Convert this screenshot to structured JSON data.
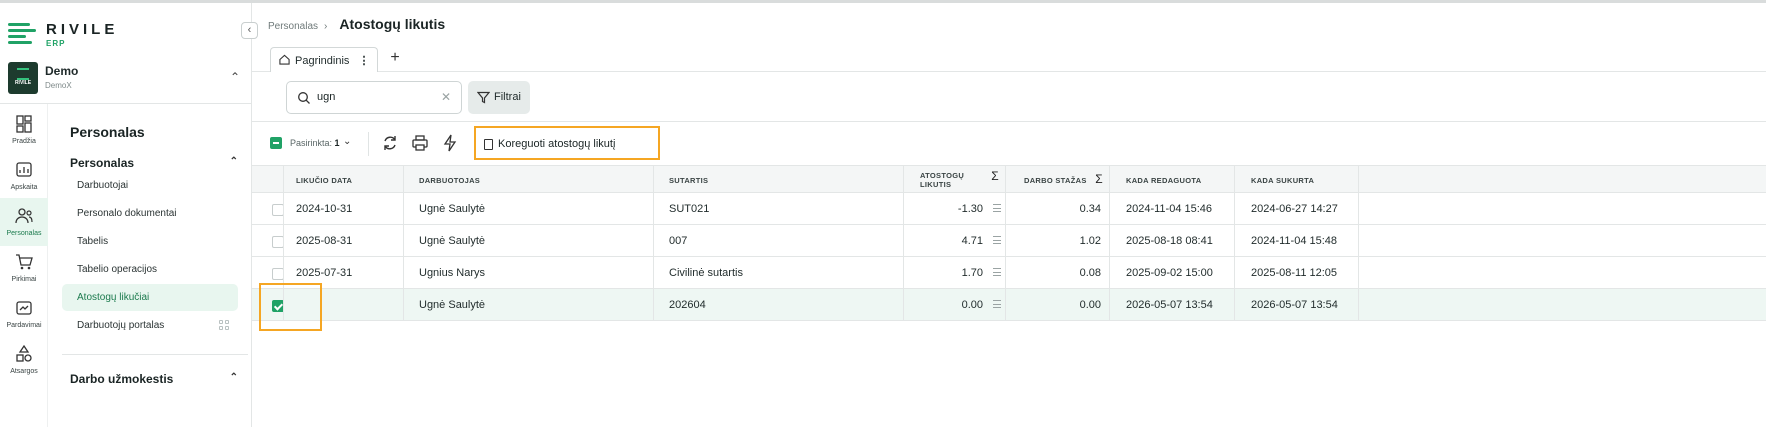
{
  "brand": {
    "name": "RIVILE",
    "sub": "ERP"
  },
  "company": {
    "name": "Demo",
    "sub": "DemoX",
    "logo_text": "RIVILE"
  },
  "rail": [
    {
      "label": "Pradžia",
      "icon": "dashboard-icon"
    },
    {
      "label": "Apskaita",
      "icon": "chart-icon"
    },
    {
      "label": "Personalas",
      "icon": "people-icon"
    },
    {
      "label": "Pirkimai",
      "icon": "cart-icon"
    },
    {
      "label": "Pardavimai",
      "icon": "sales-icon"
    },
    {
      "label": "Atsargos",
      "icon": "inventory-icon"
    }
  ],
  "submenu": {
    "title": "Personalas",
    "group1": "Personalas",
    "items": [
      "Darbuotojai",
      "Personalo dokumentai",
      "Tabelis",
      "Tabelio operacijos",
      "Atostogų likučiai",
      "Darbuotojų portalas"
    ],
    "group2": "Darbo užmokestis"
  },
  "breadcrumb": {
    "parent": "Personalas",
    "current": "Atostogų likutis"
  },
  "tabs": {
    "main": "Pagrindinis",
    "add": "+"
  },
  "search": {
    "value": "ugn",
    "clear": "✕"
  },
  "filters": {
    "label": "Filtrai"
  },
  "toolbar": {
    "selected_prefix": "Pasirinkta:",
    "selected_count": "1",
    "action": "Koreguoti atostogų likutį"
  },
  "table": {
    "headers": [
      "LIKUČIO DATA",
      "DARBUOTOJAS",
      "SUTARTIS",
      "ATOSTOGŲ LIKUTIS",
      "DARBO STAŽAS",
      "KADA REDAGUOTA",
      "KADA SUKURTA"
    ],
    "rows": [
      {
        "date": "2024-10-31",
        "employee": "Ugnė Saulytė",
        "contract": "SUT021",
        "balance": "-1.30",
        "tenure": "0.34",
        "edited": "2024-11-04 15:46",
        "created": "2024-06-27 14:27"
      },
      {
        "date": "2025-08-31",
        "employee": "Ugnė Saulytė",
        "contract": "007",
        "balance": "4.71",
        "tenure": "1.02",
        "edited": "2025-08-18 08:41",
        "created": "2024-11-04 15:48"
      },
      {
        "date": "2025-07-31",
        "employee": "Ugnius Narys",
        "contract": "Civilinė sutartis",
        "balance": "1.70",
        "tenure": "0.08",
        "edited": "2025-09-02 15:00",
        "created": "2025-08-11 12:05"
      },
      {
        "date": "",
        "employee": "Ugnė Saulytė",
        "contract": "202604",
        "balance": "0.00",
        "tenure": "0.00",
        "edited": "2026-05-07 13:54",
        "created": "2026-05-07 13:54"
      }
    ]
  },
  "colors": {
    "accent": "#20a266",
    "highlight": "#f5a623"
  }
}
